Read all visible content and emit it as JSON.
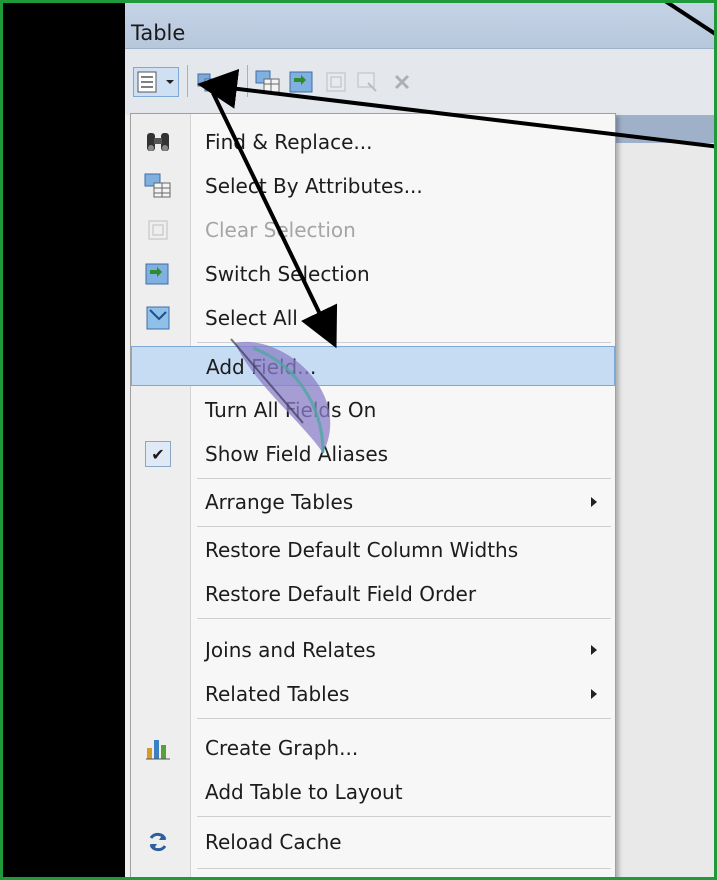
{
  "window": {
    "title": "Table"
  },
  "toolbar": {
    "buttons": [
      "table-options-icon",
      "chevron-down-icon",
      "related-tables-icon",
      "chevron-down-icon",
      "select-by-attributes-icon",
      "switch-selection-icon",
      "clear-selection-icon",
      "delete-selected-icon",
      "delete-icon"
    ]
  },
  "menu": {
    "items": [
      {
        "label": "Find & Replace...",
        "icon": "binoculars-icon"
      },
      {
        "label": "Select By Attributes...",
        "icon": "select-by-attributes-icon"
      },
      {
        "label": "Clear Selection",
        "icon": "clear-selection-icon",
        "disabled": true
      },
      {
        "label": "Switch Selection",
        "icon": "switch-selection-icon"
      },
      {
        "label": "Select All",
        "icon": "select-all-icon"
      },
      {
        "label": "Add Field...",
        "highlighted": true
      },
      {
        "label": "Turn All Fields On"
      },
      {
        "label": "Show Field Aliases",
        "checked": true
      },
      {
        "label": "Arrange Tables",
        "submenu": true
      },
      {
        "label": "Restore Default Column Widths"
      },
      {
        "label": "Restore Default Field Order"
      },
      {
        "label": "Joins and Relates",
        "submenu": true
      },
      {
        "label": "Related Tables",
        "submenu": true
      },
      {
        "label": "Create Graph...",
        "icon": "graph-icon"
      },
      {
        "label": "Add Table to Layout"
      },
      {
        "label": "Reload Cache",
        "icon": "reload-icon"
      }
    ]
  },
  "colors": {
    "frame": "#1f9a3a",
    "highlight": "#c6dcf3",
    "highlight_border": "#7ea9d6",
    "title_bar": "#c5d3e6"
  }
}
